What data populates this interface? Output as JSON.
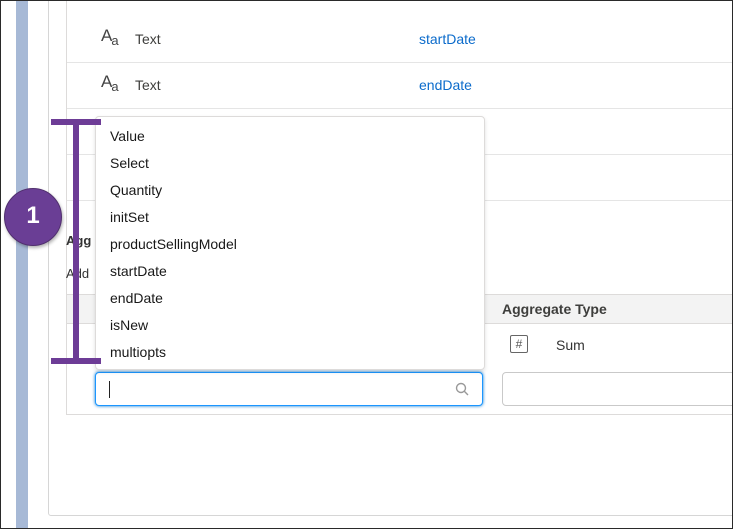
{
  "rows": [
    {
      "type_label": "Text",
      "field": "startDate"
    },
    {
      "type_label": "Text",
      "field": "endDate"
    }
  ],
  "section_partial": "Agg",
  "add_partial": "Add",
  "table_header": {
    "aggregate_type": "Aggregate Type"
  },
  "sum_row": {
    "label": "Sum"
  },
  "dropdown": {
    "items": [
      "Value",
      "Select",
      "Quantity",
      "initSet",
      "productSellingModel",
      "startDate",
      "endDate",
      "isNew",
      "multiopts"
    ]
  },
  "annotation": {
    "number": "1",
    "color": "#6a3e95"
  }
}
